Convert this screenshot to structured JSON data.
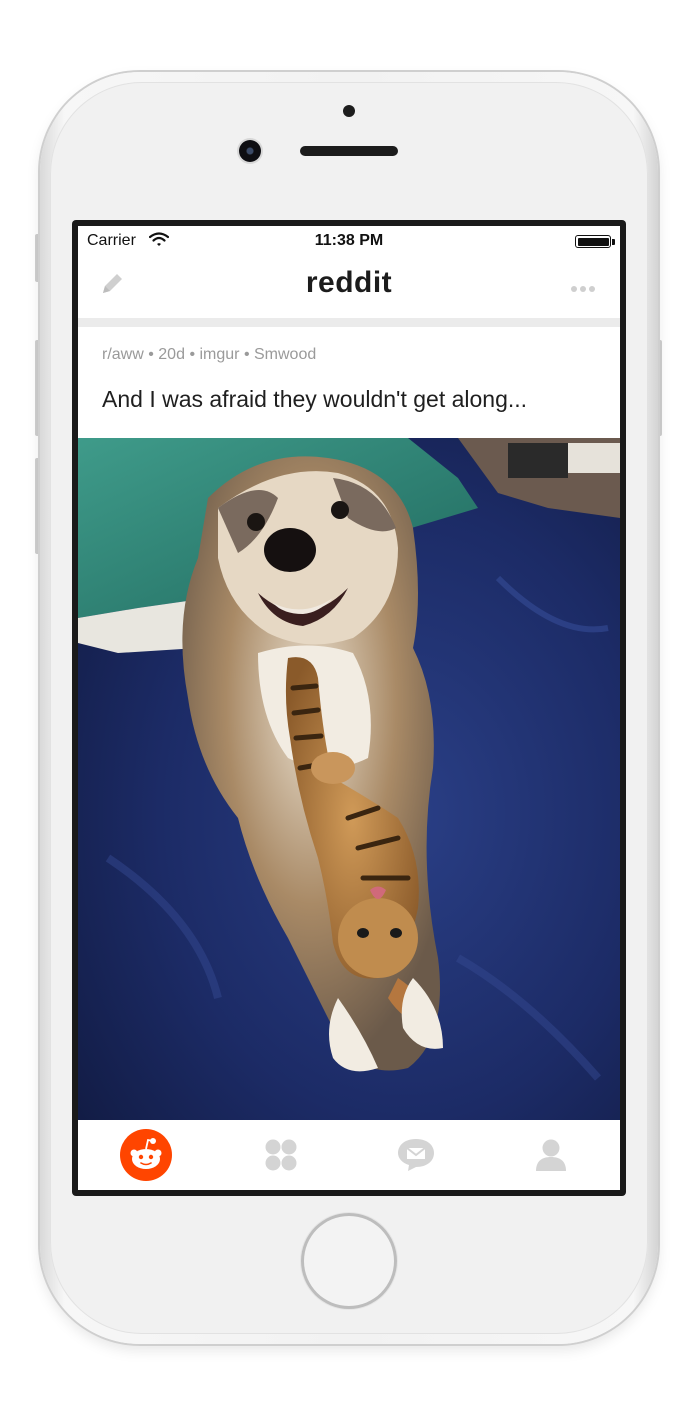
{
  "status_bar": {
    "carrier": "Carrier",
    "time": "11:38 PM",
    "wifi_icon": "wifi-icon",
    "battery_icon": "battery-icon"
  },
  "nav": {
    "title": "reddit",
    "left_icon": "pencil-icon",
    "right_icon": "more-icon"
  },
  "post": {
    "subreddit": "r/aww",
    "age": "20d",
    "domain": "imgur",
    "author": "Smwood",
    "separator": "•",
    "title": "And I was afraid they wouldn't get along...",
    "image_description_icon": "photo"
  },
  "tabs": [
    {
      "icon": "reddit-alien-icon",
      "active": true
    },
    {
      "icon": "grid-icon",
      "active": false
    },
    {
      "icon": "message-icon",
      "active": false
    },
    {
      "icon": "profile-icon",
      "active": false
    }
  ],
  "colors": {
    "accent": "#ff4500",
    "tab_inactive": "#d4d4d4",
    "meta_text": "#9a9a9a"
  }
}
